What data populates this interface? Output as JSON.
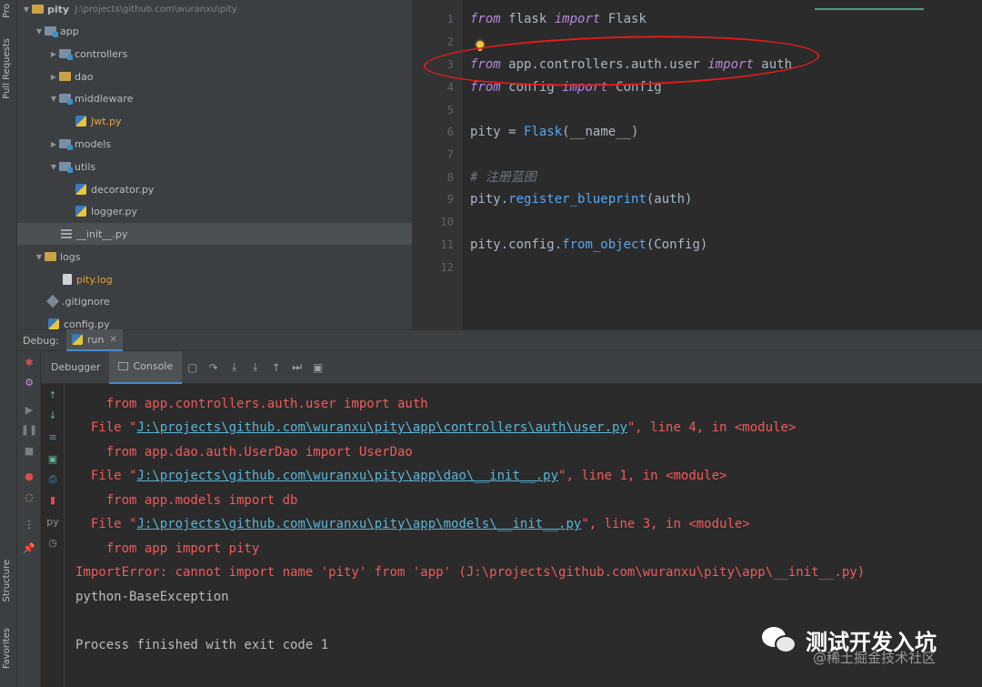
{
  "left_strip": {
    "project_tab": "Pro",
    "pull_requests_tab": "Pull Requests",
    "structure_tab": "Structure",
    "favorites_tab": "Favorites"
  },
  "project_tree": {
    "root_name": "pity",
    "root_path": "J:\\projects\\github.com\\wuranxu\\pity",
    "items": [
      {
        "label": "app"
      },
      {
        "label": "controllers"
      },
      {
        "label": "dao"
      },
      {
        "label": "middleware"
      },
      {
        "label": "Jwt.py"
      },
      {
        "label": "models"
      },
      {
        "label": "utils"
      },
      {
        "label": "decorator.py"
      },
      {
        "label": "logger.py"
      },
      {
        "label": "__init__.py"
      },
      {
        "label": "logs"
      },
      {
        "label": "pity.log"
      },
      {
        "label": ".gitignore"
      },
      {
        "label": "config.py"
      }
    ]
  },
  "editor": {
    "line_numbers": [
      "1",
      "2",
      "3",
      "4",
      "5",
      "6",
      "7",
      "8",
      "9",
      "10",
      "11",
      "12"
    ],
    "l1": {
      "kw1": "from",
      "mod": " flask ",
      "kw2": "import",
      "name": " Flask"
    },
    "l3": {
      "kw1": "from",
      "mod": " app.controllers.auth.user ",
      "kw2": "import",
      "name": " auth"
    },
    "l4": {
      "kw1": "from",
      "mod": " config ",
      "kw2": "import",
      "name": " Config"
    },
    "l6": {
      "a": "pity = ",
      "fn": "Flask",
      "b": "(__name__)"
    },
    "l8": {
      "comment": "# 注册蓝图"
    },
    "l9": {
      "a": "pity.",
      "fn": "register_blueprint",
      "b": "(auth)"
    },
    "l11": {
      "a": "pity.config.",
      "fn": "from_object",
      "b": "(Config)"
    }
  },
  "debug": {
    "label": "Debug:",
    "run_tab": "run",
    "tabs": {
      "debugger": "Debugger",
      "console": "Console"
    }
  },
  "console": {
    "l1": "    from app.controllers.auth.user import auth",
    "l2_pre": "  File \"",
    "l2_link": "J:\\projects\\github.com\\wuranxu\\pity\\app\\controllers\\auth\\user.py",
    "l2_post": "\", line 4, in <module>",
    "l3": "    from app.dao.auth.UserDao import UserDao",
    "l4_pre": "  File \"",
    "l4_link": "J:\\projects\\github.com\\wuranxu\\pity\\app\\dao\\__init__.py",
    "l4_post": "\", line 1, in <module>",
    "l5": "    from app.models import db",
    "l6_pre": "  File \"",
    "l6_link": "J:\\projects\\github.com\\wuranxu\\pity\\app\\models\\__init__.py",
    "l6_post": "\", line 3, in <module>",
    "l7": "    from app import pity",
    "l8": "ImportError: cannot import name 'pity' from 'app' (J:\\projects\\github.com\\wuranxu\\pity\\app\\__init__.py)",
    "l9": "python-BaseException",
    "l10": "Process finished with exit code 1"
  },
  "watermark": {
    "title": "测试开发入坑",
    "sub": "@稀土掘金技术社区"
  }
}
